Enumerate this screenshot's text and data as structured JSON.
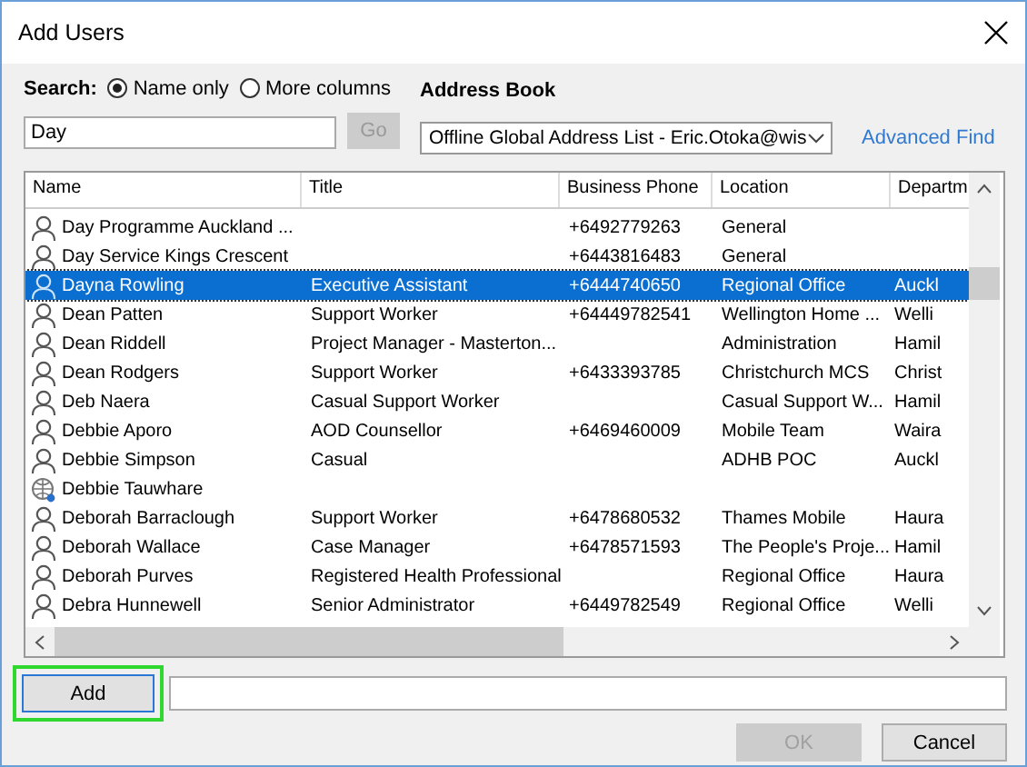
{
  "window": {
    "title": "Add Users"
  },
  "search": {
    "label": "Search:",
    "options": [
      {
        "label": "Name only",
        "selected": true
      },
      {
        "label": "More columns",
        "selected": false
      }
    ],
    "value": "Day",
    "go_button": {
      "label": "Go",
      "disabled": true
    }
  },
  "address_book": {
    "label": "Address Book",
    "value": "Offline Global Address List - Eric.Otoka@wis",
    "advanced_find": "Advanced Find"
  },
  "table": {
    "columns": [
      "Name",
      "Title",
      "Business Phone",
      "Location",
      "Departm"
    ],
    "rows": [
      {
        "kind": "user",
        "selected": false,
        "cells": [
          "Day Programme Auckland ...",
          "",
          "+6492779263",
          "General",
          ""
        ]
      },
      {
        "kind": "user",
        "selected": false,
        "cells": [
          "Day Service Kings Crescent",
          "",
          "+6443816483",
          "General",
          ""
        ]
      },
      {
        "kind": "user",
        "selected": true,
        "cells": [
          "Dayna Rowling",
          "Executive Assistant",
          "+6444740650",
          "Regional Office",
          "Auckl"
        ]
      },
      {
        "kind": "user",
        "selected": false,
        "cells": [
          "Dean Patten",
          "Support Worker",
          "+64449782541",
          "Wellington Home ...",
          "Welli"
        ]
      },
      {
        "kind": "user",
        "selected": false,
        "cells": [
          "Dean Riddell",
          "Project Manager - Masterton...",
          "",
          "Administration",
          "Hamil"
        ]
      },
      {
        "kind": "user",
        "selected": false,
        "cells": [
          "Dean Rodgers",
          "Support Worker",
          "+6433393785",
          "Christchurch MCS",
          "Christ"
        ]
      },
      {
        "kind": "user",
        "selected": false,
        "cells": [
          "Deb Naera",
          "Casual Support Worker",
          "",
          "Casual Support W...",
          "Hamil"
        ]
      },
      {
        "kind": "user",
        "selected": false,
        "cells": [
          "Debbie Aporo",
          "AOD Counsellor",
          "+6469460009",
          "Mobile Team",
          "Waira"
        ]
      },
      {
        "kind": "user",
        "selected": false,
        "cells": [
          "Debbie Simpson",
          "Casual",
          "",
          "ADHB POC",
          "Auckl"
        ]
      },
      {
        "kind": "contact",
        "selected": false,
        "cells": [
          "Debbie Tauwhare",
          "",
          "",
          "",
          ""
        ]
      },
      {
        "kind": "user",
        "selected": false,
        "cells": [
          "Deborah Barraclough",
          "Support Worker",
          "+6478680532",
          "Thames Mobile",
          "Haura"
        ]
      },
      {
        "kind": "user",
        "selected": false,
        "cells": [
          "Deborah Wallace",
          "Case Manager",
          "+6478571593",
          "The People's Proje...",
          "Hamil"
        ]
      },
      {
        "kind": "user",
        "selected": false,
        "cells": [
          "Deborah Purves",
          "Registered Health Professional",
          "",
          "Regional Office",
          "Haura"
        ]
      },
      {
        "kind": "user",
        "selected": false,
        "cells": [
          "Debra Hunnewell",
          "Senior Administrator",
          "+6449782549",
          "Regional Office",
          "Welli"
        ]
      }
    ]
  },
  "add_button": {
    "label": "Add",
    "highlighted": true
  },
  "buttons": [
    {
      "label": "OK",
      "disabled": true
    },
    {
      "label": "Cancel",
      "disabled": false
    }
  ]
}
